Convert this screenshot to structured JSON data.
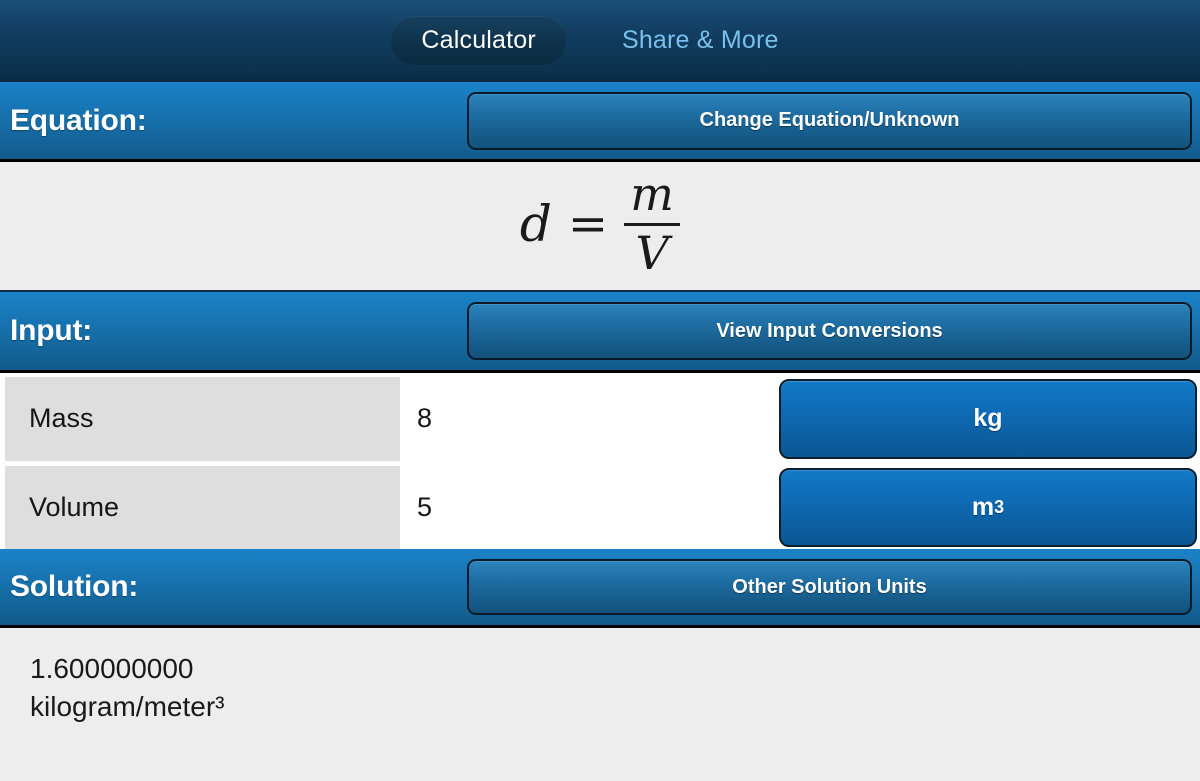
{
  "app": {
    "accent_blue": "#1878b8",
    "dark_navy": "#0d3552",
    "button_blue": "#0f6fbb",
    "light_blue_text": "#79c0ea",
    "panel_gray": "#ededed",
    "label_gray": "#dedede"
  },
  "tabs": [
    {
      "label": "Calculator",
      "state": "active"
    },
    {
      "label": "Share & More",
      "state": "inactive"
    }
  ],
  "sections": {
    "equation": {
      "title": "Equation:",
      "button": "Change Equation/Unknown",
      "formula": {
        "lhs": "d",
        "operator": "=",
        "numerator": "m",
        "denominator": "V",
        "plain": "d = m/V"
      }
    },
    "input": {
      "title": "Input:",
      "button": "View Input Conversions",
      "rows": [
        {
          "label": "Mass",
          "value": "8",
          "unit": "kg",
          "unit_base": "kg",
          "unit_exponent": ""
        },
        {
          "label": "Volume",
          "value": "5",
          "unit": "m³",
          "unit_base": "m",
          "unit_exponent": "3"
        }
      ]
    },
    "solution": {
      "title": "Solution:",
      "button": "Other Solution Units",
      "result_value": "1.600000000",
      "result_units": "kilogram/meter³"
    }
  }
}
